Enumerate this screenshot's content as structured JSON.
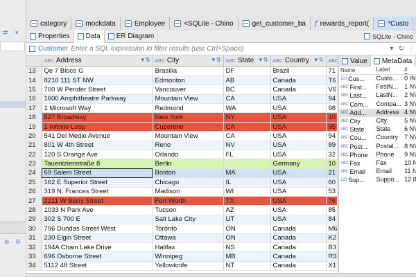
{
  "editor_tabs": [
    {
      "label": "category",
      "icon": "table-icon",
      "active": false
    },
    {
      "label": "mockdata",
      "icon": "table-icon",
      "active": false
    },
    {
      "label": "Employee",
      "icon": "table-icon",
      "active": false
    },
    {
      "label": "<SQLite - Chino",
      "icon": "sql-script-icon",
      "active": false
    },
    {
      "label": "get_customer_ba",
      "icon": "table-icon",
      "active": false
    },
    {
      "label": "rewards_report(",
      "icon": "function-icon",
      "active": false
    },
    {
      "label": "*Custo",
      "icon": "table-icon",
      "active": true
    }
  ],
  "sub_tabs": {
    "properties": "Properties",
    "data": "Data",
    "er_diagram": "ER Diagram",
    "connection": "SQLite - Chino"
  },
  "filter": {
    "label": "Customer",
    "placeholder": "Enter a SQL expression to filter results (use Ctrl+Space)"
  },
  "grid": {
    "columns": [
      "Address",
      "City",
      "State",
      "Country",
      "P"
    ],
    "rows": [
      {
        "n": "13",
        "address": "Qe 7 Bloco G",
        "city": "Brasília",
        "state": "DF",
        "country": "Brazil",
        "extra": "71",
        "style": "normal"
      },
      {
        "n": "14",
        "address": "8210 111 ST NW",
        "city": "Edmonton",
        "state": "AB",
        "country": "Canada",
        "extra": "T6",
        "style": "alt"
      },
      {
        "n": "15",
        "address": "700 W Pender Street",
        "city": "Vancouver",
        "state": "BC",
        "country": "Canada",
        "extra": "V6",
        "style": "normal"
      },
      {
        "n": "16",
        "address": "1600 Amphitheatre Parkway",
        "city": "Mountain View",
        "state": "CA",
        "country": "USA",
        "extra": "94",
        "style": "alt"
      },
      {
        "n": "17",
        "address": "1 Microsoft Way",
        "city": "Redmond",
        "state": "WA",
        "country": "USA",
        "extra": "98",
        "style": "normal"
      },
      {
        "n": "18",
        "address": "627 Broadway",
        "city": "New York",
        "state": "NY",
        "country": "USA",
        "extra": "10",
        "style": "red"
      },
      {
        "n": "19",
        "address": "1 Infinite Loop",
        "city": "Cupertino",
        "state": "CA",
        "country": "USA",
        "extra": "95",
        "style": "red"
      },
      {
        "n": "20",
        "address": "541 Del Medio Avenue",
        "city": "Mountain View",
        "state": "CA",
        "country": "USA",
        "extra": "94",
        "style": "normal"
      },
      {
        "n": "21",
        "address": "801 W 4th Street",
        "city": "Reno",
        "state": "NV",
        "country": "USA",
        "extra": "89",
        "style": "alt"
      },
      {
        "n": "22",
        "address": "120 S Orange Ave",
        "city": "Orlando",
        "state": "FL",
        "country": "USA",
        "extra": "32",
        "style": "normal"
      },
      {
        "n": "23",
        "address": "Tauentzienstraße 8",
        "city": "Berlin",
        "state": "",
        "country": "Germany",
        "extra": "10",
        "style": "green"
      },
      {
        "n": "24",
        "address": "69 Salem Street",
        "city": "Boston",
        "state": "MA",
        "country": "USA",
        "extra": "21",
        "style": "sel"
      },
      {
        "n": "25",
        "address": "162 E Superior Street",
        "city": "Chicago",
        "state": "IL",
        "country": "USA",
        "extra": "60",
        "style": "alt"
      },
      {
        "n": "26",
        "address": "319 N. Frances Street",
        "city": "Madison",
        "state": "WI",
        "country": "USA",
        "extra": "53",
        "style": "normal"
      },
      {
        "n": "27",
        "address": "2211 W Berry Street",
        "city": "Fort Worth",
        "state": "TX",
        "country": "USA",
        "extra": "76",
        "style": "red"
      },
      {
        "n": "28",
        "address": "1033 N Park Ave",
        "city": "Tucson",
        "state": "AZ",
        "country": "USA",
        "extra": "85",
        "style": "normal"
      },
      {
        "n": "29",
        "address": "302 S 700 E",
        "city": "Salt Lake City",
        "state": "UT",
        "country": "USA",
        "extra": "84",
        "style": "alt"
      },
      {
        "n": "30",
        "address": "796 Dundas Street West",
        "city": "Toronto",
        "state": "ON",
        "country": "Canada",
        "extra": "M6",
        "style": "normal"
      },
      {
        "n": "31",
        "address": "230 Elgin Street",
        "city": "Ottawa",
        "state": "ON",
        "country": "Canada",
        "extra": "K2",
        "style": "alt"
      },
      {
        "n": "32",
        "address": "194A Chain Lake Drive",
        "city": "Halifax",
        "state": "NS",
        "country": "Canada",
        "extra": "B3",
        "style": "normal"
      },
      {
        "n": "33",
        "address": "696 Osborne Street",
        "city": "Winnipeg",
        "state": "MB",
        "country": "Canada",
        "extra": "R3",
        "style": "alt"
      },
      {
        "n": "34",
        "address": "5112 48 Street",
        "city": "Yellowknife",
        "state": "NT",
        "country": "Canada",
        "extra": "X1",
        "style": "normal"
      }
    ]
  },
  "right_panel": {
    "tabs": [
      "Value",
      "MetaData"
    ],
    "headers": [
      "Name",
      "Label",
      "# Typ"
    ],
    "rows": [
      {
        "name": "Cus...",
        "label": "Custo...",
        "num": "0 INT",
        "type": "num"
      },
      {
        "name": "First...",
        "label": "FirstN...",
        "num": "1 NV",
        "type": "abc"
      },
      {
        "name": "Last...",
        "label": "LastN...",
        "num": "2 NV",
        "type": "abc"
      },
      {
        "name": "Com...",
        "label": "Compa...",
        "num": "3 NV",
        "type": "abc"
      },
      {
        "name": "Add...",
        "label": "Address",
        "num": "4 NV",
        "type": "abc",
        "selected": true
      },
      {
        "name": "City",
        "label": "City",
        "num": "5 NV",
        "type": "abc"
      },
      {
        "name": "State",
        "label": "State",
        "num": "6 NV",
        "type": "abc"
      },
      {
        "name": "Cou...",
        "label": "Country",
        "num": "7 NV",
        "type": "abc"
      },
      {
        "name": "Post...",
        "label": "Postal...",
        "num": "8 NV",
        "type": "abc"
      },
      {
        "name": "Phone",
        "label": "Phone",
        "num": "9 NV",
        "type": "abc"
      },
      {
        "name": "Fax",
        "label": "Fax",
        "num": "10 NV",
        "type": "abc"
      },
      {
        "name": "Email",
        "label": "Email",
        "num": "11 NV",
        "type": "abc"
      },
      {
        "name": "Sup...",
        "label": "Suppo...",
        "num": "12 INT",
        "type": "num"
      }
    ]
  },
  "colors": {
    "red_row": "#e6553d",
    "green_row": "#d7f2b2",
    "selected_row": "#cfe0f6",
    "alt_row": "#eef3fb",
    "accent": "#4a78b8"
  }
}
